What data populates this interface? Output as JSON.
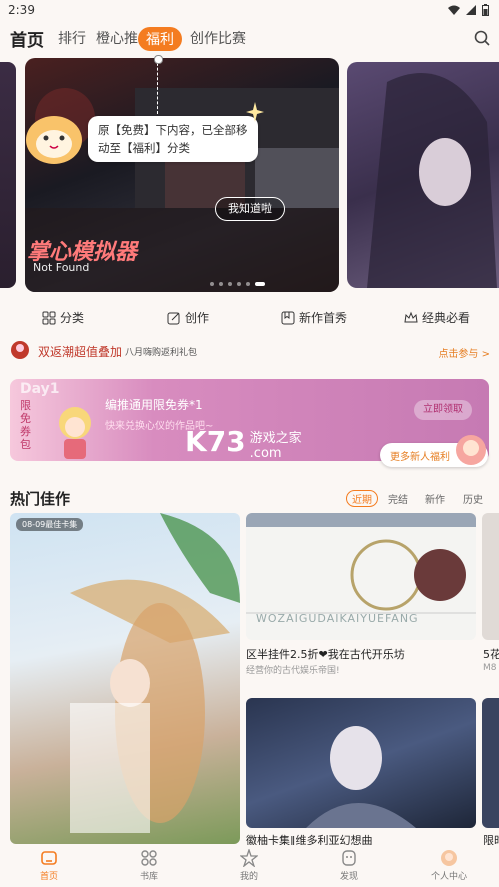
{
  "status_bar": {
    "time": "2:39"
  },
  "nav": {
    "tabs": [
      "首页",
      "排行",
      "橙心推",
      "福利",
      "创作比赛"
    ],
    "active": "首页",
    "highlight": "福利"
  },
  "banner": {
    "tooltip_text": "原【免费】下内容，已全部移动至【福利】分类",
    "know_button": "我知道啦",
    "poster_title": "掌心模拟器",
    "poster_sub": "Not Found"
  },
  "quick_actions": [
    "分类",
    "创作",
    "新作首秀",
    "经典必看"
  ],
  "promo": {
    "badge": "双返潮超值叠加",
    "text": "八月嗨购返利礼包",
    "link": "点击参与 >"
  },
  "coupon": {
    "day": "Day1",
    "vertical": [
      "限",
      "免",
      "券",
      "包"
    ],
    "title": "编推通用限免券*1",
    "subtitle": "快来兑换心仪的作品吧~",
    "claim_button": "立即领取",
    "newbie_button": "更多新人福利",
    "watermark_logo": "K73",
    "watermark_text": "游戏之家",
    "watermark_domain": ".com"
  },
  "hot": {
    "title": "热门佳作",
    "filters": [
      "近期",
      "完结",
      "新作",
      "历史"
    ],
    "active_filter": "近期",
    "works": [
      {
        "tag": "08-09最佳卡集",
        "title": "",
        "sub": ""
      },
      {
        "tag": "",
        "title": "区半挂件2.5折❤我在古代开乐坊",
        "sub": "经营你的古代娱乐帝国!",
        "cover_text": "WOZAIGUDAIKAIYUEFANG"
      },
      {
        "tag": "",
        "title": "徽柚卡集‖维多利亚幻想曲",
        "sub": ""
      },
      {
        "tag": "",
        "title": "5花",
        "sub": "M8"
      },
      {
        "tag": "",
        "title": "限时",
        "sub": ""
      }
    ]
  },
  "bottom_nav": [
    "首页",
    "书库",
    "我的",
    "发现",
    "个人中心"
  ],
  "colors": {
    "accent": "#f47c20",
    "bg": "#fbf7f4"
  }
}
